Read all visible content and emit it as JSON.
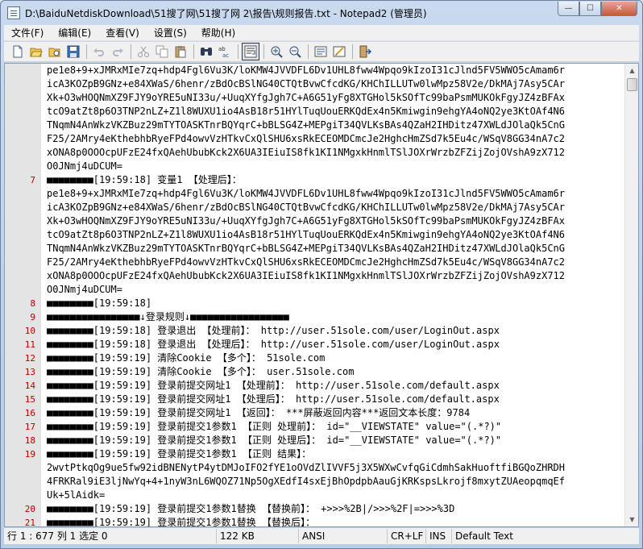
{
  "window": {
    "title": "D:\\BaiduNetdiskDownload\\51搜了网\\51搜了网 2\\报告\\规则报告.txt - Notepad2 (管理员)",
    "minimize_glyph": "—",
    "maximize_glyph": "☐",
    "close_glyph": "✕"
  },
  "menu": [
    {
      "label": "文件(F)"
    },
    {
      "label": "编辑(E)"
    },
    {
      "label": "查看(V)"
    },
    {
      "label": "设置(S)"
    },
    {
      "label": "帮助(H)"
    }
  ],
  "toolbar": {
    "icons": [
      "new-file-icon",
      "open-folder-icon",
      "browse-icon",
      "save-icon",
      "undo-icon",
      "redo-icon",
      "cut-icon",
      "copy-icon",
      "paste-icon",
      "find-icon",
      "replace-icon",
      "word-wrap-icon",
      "zoom-in-icon",
      "zoom-out-icon",
      "scheme-icon",
      "customize-scheme-icon",
      "exit-icon"
    ],
    "active": "word-wrap-icon"
  },
  "editor": {
    "lines": [
      {
        "n": "",
        "t": "pe1e8+9+xJMRxMIe7zq+hdp4Fgl6Vu3K/loKMW4JVVDFL6Dv1UHL8fww4Wpqo9kIzoI31cJlnd5FV5WWO5cAmam6r"
      },
      {
        "n": "",
        "t": "icA3KOZpB9GNz+e84XWaS/6henr/zBdOcBSlNG40CTQtBvwCfcdKG/KHChILLUTw0lwMpz58V2e/DkMAj7Asy5CAr"
      },
      {
        "n": "",
        "t": "Xk+O3wHOQNmXZ9FJY9oYRE5uNI33u/+UuqXYfgJgh7C+A6G51yFg8XTGHol5kSOfTc99baPsmMUKOkFgyJZ4zBFAx"
      },
      {
        "n": "",
        "t": "tcO9atZt8p6O3TNP2nLZ+Z1l8WUXU1io4AsB18r51HYlTuqUouERKQdEx4n5Kmiwgin9ehgYA4oNQ2ye3KtOAf4N6"
      },
      {
        "n": "",
        "t": "TNqmN4AnWkzVKZBuz29mTYTOASKTnrBQYqrC+bBLSG4Z+MEPgiT34QVLKsBAs4QZaH2IHDitz47XWLdJOlaQk5CnG"
      },
      {
        "n": "",
        "t": "F25/2AMry4eKthebhbRyeFPd4owvVzHTkvCxQlSHU6xsRkECEOMDCmcJe2HghcHmZSd7k5Eu4c/WSqV8GG34nA7c2"
      },
      {
        "n": "",
        "t": "xONA8p0OOOcpUFzE24fxQAehUbubKck2X6UA3IEiuIS8fk1KI1NMgxkHnmlTSlJOXrWrzbZFZijZojOVshA9zX712"
      },
      {
        "n": "",
        "t": "O0JNmj4uDCUM="
      },
      {
        "n": "7",
        "t": "■■■■■■■■[19:59:18] 变量1 【处理后】："
      },
      {
        "n": "",
        "t": "pe1e8+9+xJMRxMIe7zq+hdp4Fgl6Vu3K/loKMW4JVVDFL6Dv1UHL8fww4Wpqo9kIzoI31cJlnd5FV5WWO5cAmam6r"
      },
      {
        "n": "",
        "t": "icA3KOZpB9GNz+e84XWaS/6henr/zBdOcBSlNG40CTQtBvwCfcdKG/KHChILLUTw0lwMpz58V2e/DkMAj7Asy5CAr"
      },
      {
        "n": "",
        "t": "Xk+O3wHOQNmXZ9FJY9oYRE5uNI33u/+UuqXYfgJgh7C+A6G51yFg8XTGHol5kSOfTc99baPsmMUKOkFgyJZ4zBFAx"
      },
      {
        "n": "",
        "t": "tcO9atZt8p6O3TNP2nLZ+Z1l8WUXU1io4AsB18r51HYlTuqUouERKQdEx4n5Kmiwgin9ehgYA4oNQ2ye3KtOAf4N6"
      },
      {
        "n": "",
        "t": "TNqmN4AnWkzVKZBuz29mTYTOASKTnrBQYqrC+bBLSG4Z+MEPgiT34QVLKsBAs4QZaH2IHDitz47XWLdJOlaQk5CnG"
      },
      {
        "n": "",
        "t": "F25/2AMry4eKthebhbRyeFPd4owvVzHTkvCxQlSHU6xsRkECEOMDCmcJe2HghcHmZSd7k5Eu4c/WSqV8GG34nA7c2"
      },
      {
        "n": "",
        "t": "xONA8p0OOOcpUFzE24fxQAehUbubKck2X6UA3IEiuIS8fk1KI1NMgxkHnmlTSlJOXrWrzbZFZijZojOVshA9zX712"
      },
      {
        "n": "",
        "t": "O0JNmj4uDCUM="
      },
      {
        "n": "8",
        "t": "■■■■■■■■[19:59:18]"
      },
      {
        "n": "9",
        "t": "■■■■■■■■■■■■■■■■↓登录规则↓■■■■■■■■■■■■■■■■■"
      },
      {
        "n": "10",
        "t": "■■■■■■■■[19:59:18] 登录退出 【处理前】： http://user.51sole.com/user/LoginOut.aspx"
      },
      {
        "n": "11",
        "t": "■■■■■■■■[19:59:18] 登录退出 【处理后】： http://user.51sole.com/user/LoginOut.aspx"
      },
      {
        "n": "12",
        "t": "■■■■■■■■[19:59:19] 清除Cookie 【多个】： 51sole.com"
      },
      {
        "n": "13",
        "t": "■■■■■■■■[19:59:19] 清除Cookie 【多个】： user.51sole.com"
      },
      {
        "n": "14",
        "t": "■■■■■■■■[19:59:19] 登录前提交网址1 【处理前】： http://user.51sole.com/default.aspx"
      },
      {
        "n": "15",
        "t": "■■■■■■■■[19:59:19] 登录前提交网址1 【处理后】： http://user.51sole.com/default.aspx"
      },
      {
        "n": "16",
        "t": "■■■■■■■■[19:59:19] 登录前提交网址1 【返回】： ***屏蔽返回内容***返回文本长度：9784"
      },
      {
        "n": "17",
        "t": "■■■■■■■■[19:59:19] 登录前提交1参数1 【正则 处理前】： id=\"__VIEWSTATE\" value=\"(.*?)\""
      },
      {
        "n": "18",
        "t": "■■■■■■■■[19:59:19] 登录前提交1参数1 【正则 处理后】： id=\"__VIEWSTATE\" value=\"(.*?)\""
      },
      {
        "n": "19",
        "t": "■■■■■■■■[19:59:19] 登录前提交1参数1 【正则 结果】："
      },
      {
        "n": "",
        "t": "2wvtPtkqOg9ue5fw92idBNENytP4ytDMJoIFO2fYE1oOVdZlIVVF5j3X5WXwCvfqGiCdmhSakHuoftfiBGQoZHRDH"
      },
      {
        "n": "",
        "t": "4FRKRal9iE3ljNwYq+4+1nyW3nL6WQOZ71Np5OgXEdfI4sxEjBhOpdpbAauGjKRKspsLkrojf8mxytZUAeopqmqEf"
      },
      {
        "n": "",
        "t": "Uk+5lAidk="
      },
      {
        "n": "20",
        "t": "■■■■■■■■[19:59:19] 登录前提交1参数1替换 【替换前】： +>>>%2B|/>>>%2F|=>>>%3D"
      },
      {
        "n": "21",
        "t": "■■■■■■■■[19:59:19] 登录前提交1参数1替换 【替换后】："
      }
    ]
  },
  "status": [
    {
      "label": "行 1 : 677  列 1  选定 0"
    },
    {
      "label": "122 KB"
    },
    {
      "label": "ANSI"
    },
    {
      "label": "CR+LF"
    },
    {
      "label": "INS"
    },
    {
      "label": "Default Text"
    }
  ]
}
